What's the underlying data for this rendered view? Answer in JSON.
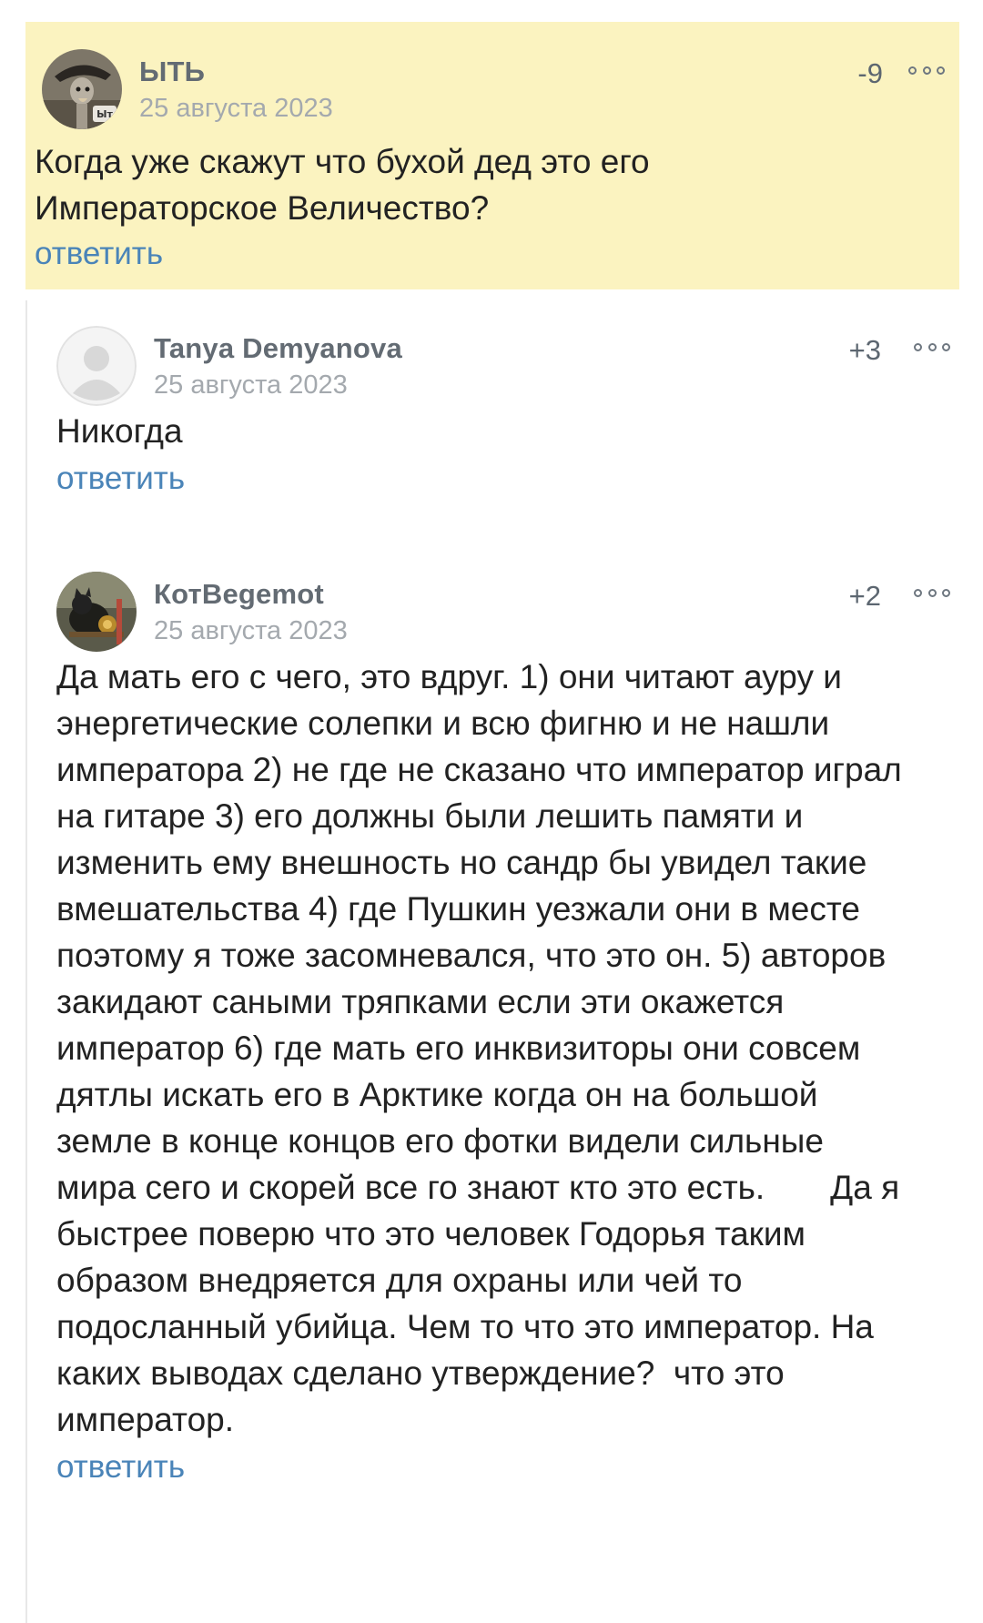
{
  "comments": [
    {
      "author": "ЫТЬ",
      "date": "25 августа 2023",
      "score": "-9",
      "avatar_badge": "Ыт",
      "text": "Когда уже скажут что бухой дед это его\nИмператорское Величество?",
      "reply_label": "ответить",
      "highlight_color": "#fbf3c0"
    }
  ],
  "replies": [
    {
      "author": "Tanya Demyanova",
      "date": "25 августа 2023",
      "score": "+3",
      "avatar_icon": "default-user-icon",
      "text": "Никогда",
      "reply_label": "ответить"
    },
    {
      "author": "КотBegemot",
      "date": "25 августа 2023",
      "score": "+2",
      "avatar_icon": "photo-avatar",
      "text": "Да мать его с чего, это вдруг. 1) они читают ауру и\nэнергетические солепки и всю фигню и не нашли\nимператора 2) не где не сказано что император играл\nна гитаре 3) его должны были лешить памяти и\nизменить ему внешность но сандр бы увидел такие\nвмешательства 4) где Пушкин уезжали они в месте\nпоэтому я тоже засомневался, что это он. 5) авторов\nзакидают саными тряпками если эти окажется\nимператор 6) где мать его инквизиторы они совсем\nдятлы искать его в Арктике когда он на большой\nземле в конце концов его фотки видели сильные\nмира сего и скорей все го знают кто это есть.       Да я\nбыстрее поверю что это человек Годорья таким\nобразом внедряется для охраны или чей то\nподосланный убийца. Чем то что это император. На\nкаких выводах сделано утверждение?  что это\nимператор.",
      "reply_label": "ответить"
    }
  ],
  "colors": {
    "link": "#4a84b8",
    "author": "#636b73",
    "date": "#a4a9ae",
    "highlight": "#fbf3c0"
  }
}
